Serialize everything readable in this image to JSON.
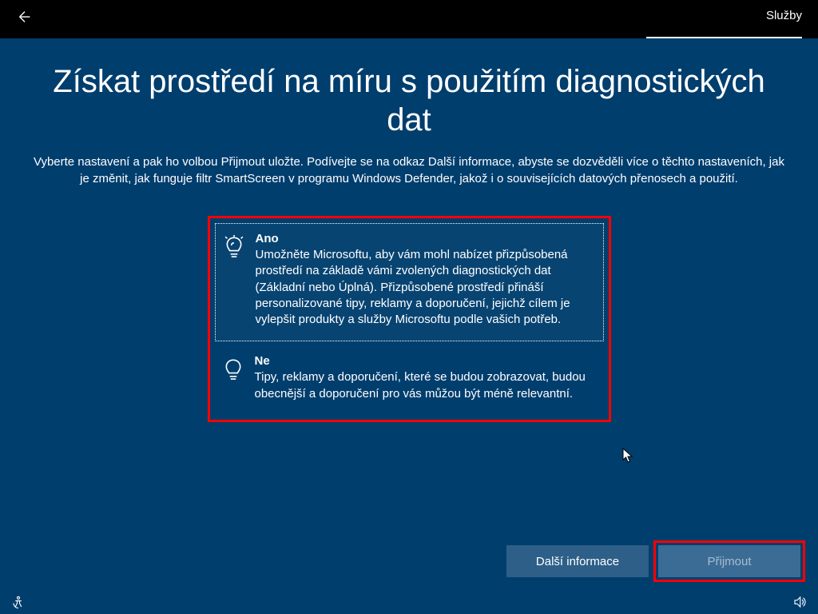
{
  "topbar": {
    "tab_label": "Služby"
  },
  "page": {
    "title": "Získat prostředí na míru s použitím diagnostických dat",
    "subtitle": "Vyberte nastavení a pak ho volbou Přijmout uložte. Podívejte se na odkaz Další informace, abyste se dozvěděli více o těchto nastaveních, jak je změnit, jak funguje filtr SmartScreen v programu Windows Defender, jakož i o souvisejících datových přenosech a použití."
  },
  "options": {
    "yes": {
      "title": "Ano",
      "desc": "Umožněte Microsoftu, aby vám mohl nabízet přizpůsobená prostředí na základě vámi zvolených diagnostických dat (Základní nebo Úplná). Přizpůsobené prostředí přináší personalizované tipy, reklamy a doporučení, jejichž cílem je vylepšit produkty a služby Microsoftu podle vašich potřeb."
    },
    "no": {
      "title": "Ne",
      "desc": "Tipy, reklamy a doporučení, které se budou zobrazovat, budou obecnější a doporučení pro vás můžou být méně relevantní."
    }
  },
  "buttons": {
    "more_info": "Další informace",
    "accept": "Přijmout"
  }
}
